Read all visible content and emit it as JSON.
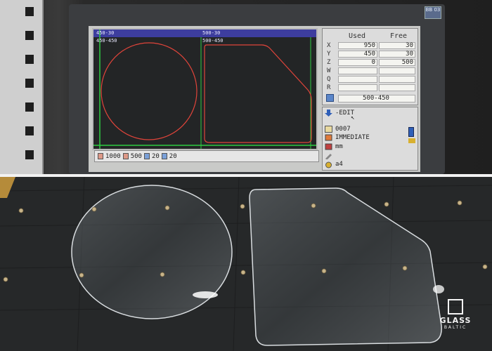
{
  "image_kind": "two-panel photo: CNC glass cutting controller screen (top) and cut glass pieces on cutting table (bottom)",
  "screen": {
    "overlay_labels": [
      "450-30",
      "500-30",
      "450-450",
      "500-450"
    ],
    "panel_headers": {
      "used": "Used",
      "free": "Free"
    },
    "axes": [
      {
        "name": "X",
        "used": "950",
        "free": "30"
      },
      {
        "name": "Y",
        "used": "450",
        "free": "30"
      },
      {
        "name": "Z",
        "used": "0",
        "free": "500"
      },
      {
        "name": "W",
        "used": "",
        "free": ""
      },
      {
        "name": "Q",
        "used": "",
        "free": ""
      },
      {
        "name": "R",
        "used": "",
        "free": ""
      }
    ],
    "sheet_size": "500-450",
    "info": {
      "mode": "-EDIT",
      "program": "0007",
      "state": "IMMEDIATE",
      "unit": "mm",
      "tool": "a4"
    },
    "status_bar": {
      "value_1": "1000",
      "value_2": "500",
      "value_3": "20",
      "value_4": "20"
    },
    "shape_colors": {
      "cut_path": "#e0443a",
      "axis_line": "#2ecc40",
      "header_band": "#3d3d9e"
    }
  },
  "brand_badge": "BB 03",
  "logo": {
    "word": "GLASS",
    "sub": "BALTIC"
  },
  "scene_colors": {
    "table": "#2a2c2e",
    "glass_edge": "#d9dde0",
    "pin": "#c8b48a"
  }
}
